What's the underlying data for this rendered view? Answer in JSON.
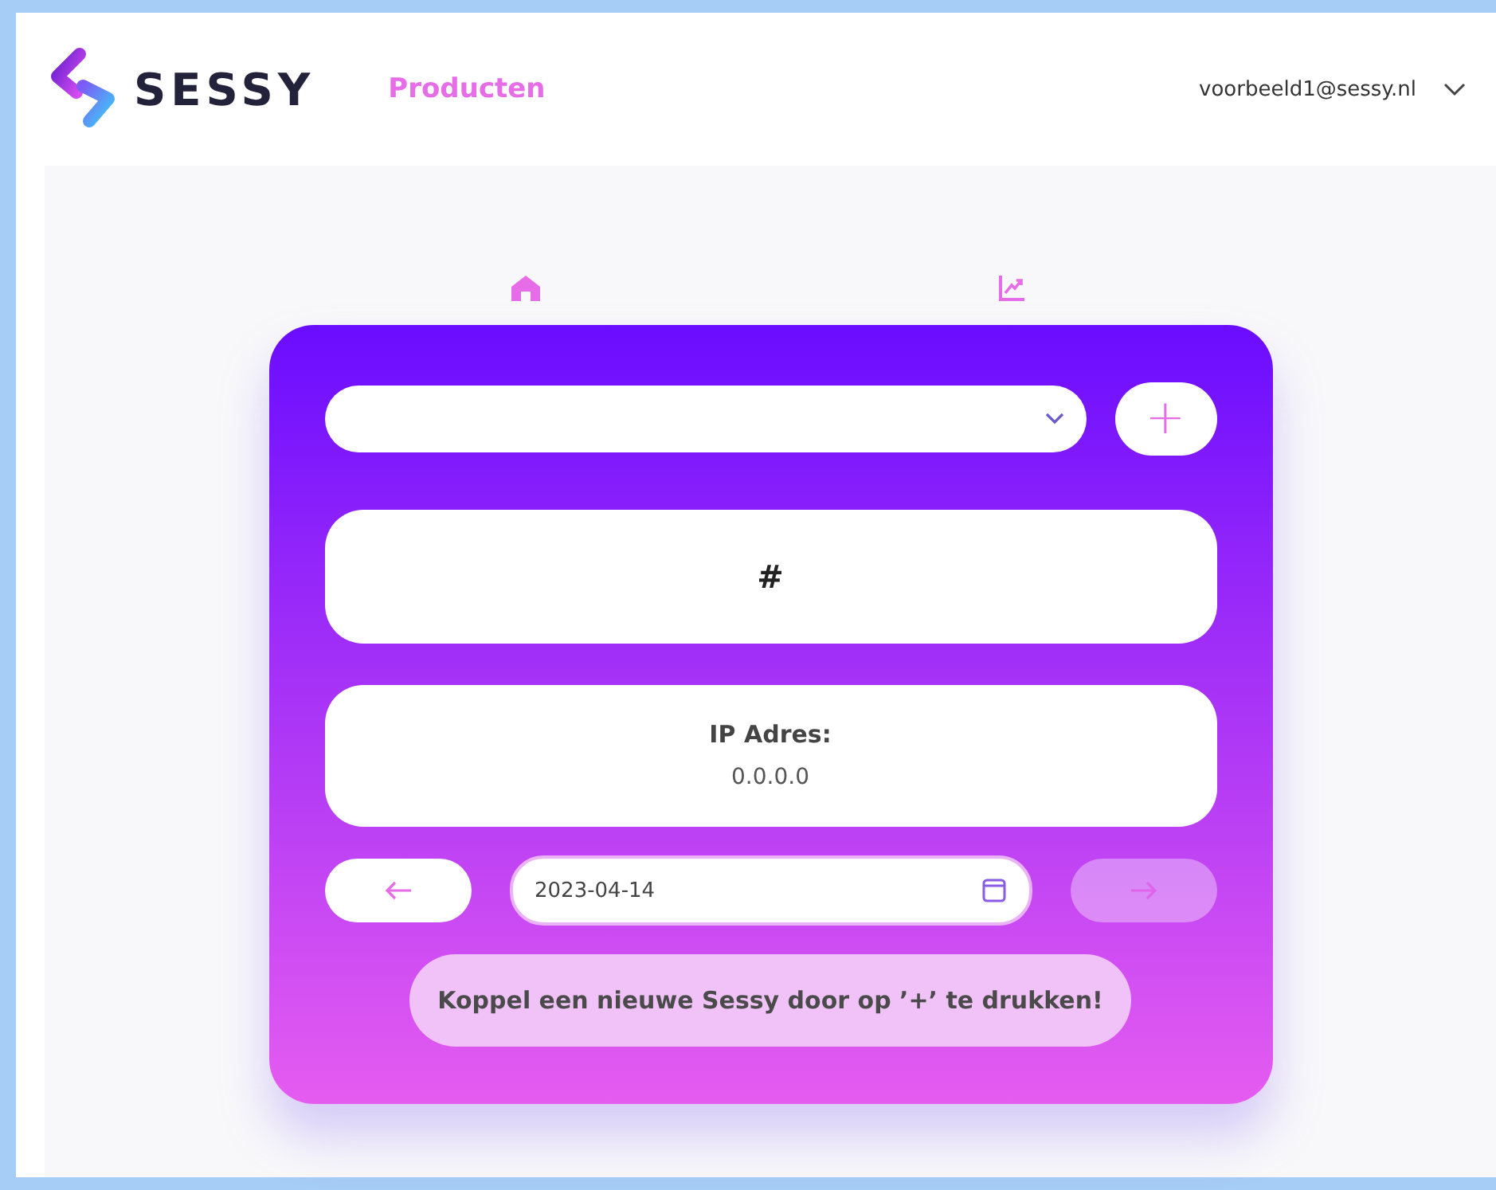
{
  "header": {
    "logo_text": "SESSY",
    "nav": [
      {
        "label": "Producten",
        "selected": true
      }
    ],
    "user_email": "voorbeeld1@sessy.nl"
  },
  "card": {
    "add_button": "+",
    "serial": "#",
    "ip_label": "IP Adres:",
    "ip_value": "0.0.0.0",
    "date": "2023-04-14",
    "prev_button": {
      "disabled": false
    },
    "next_button": {
      "disabled": true
    },
    "message": "Koppel een nieuwe Sessy door op ’+’ te drukken!"
  }
}
